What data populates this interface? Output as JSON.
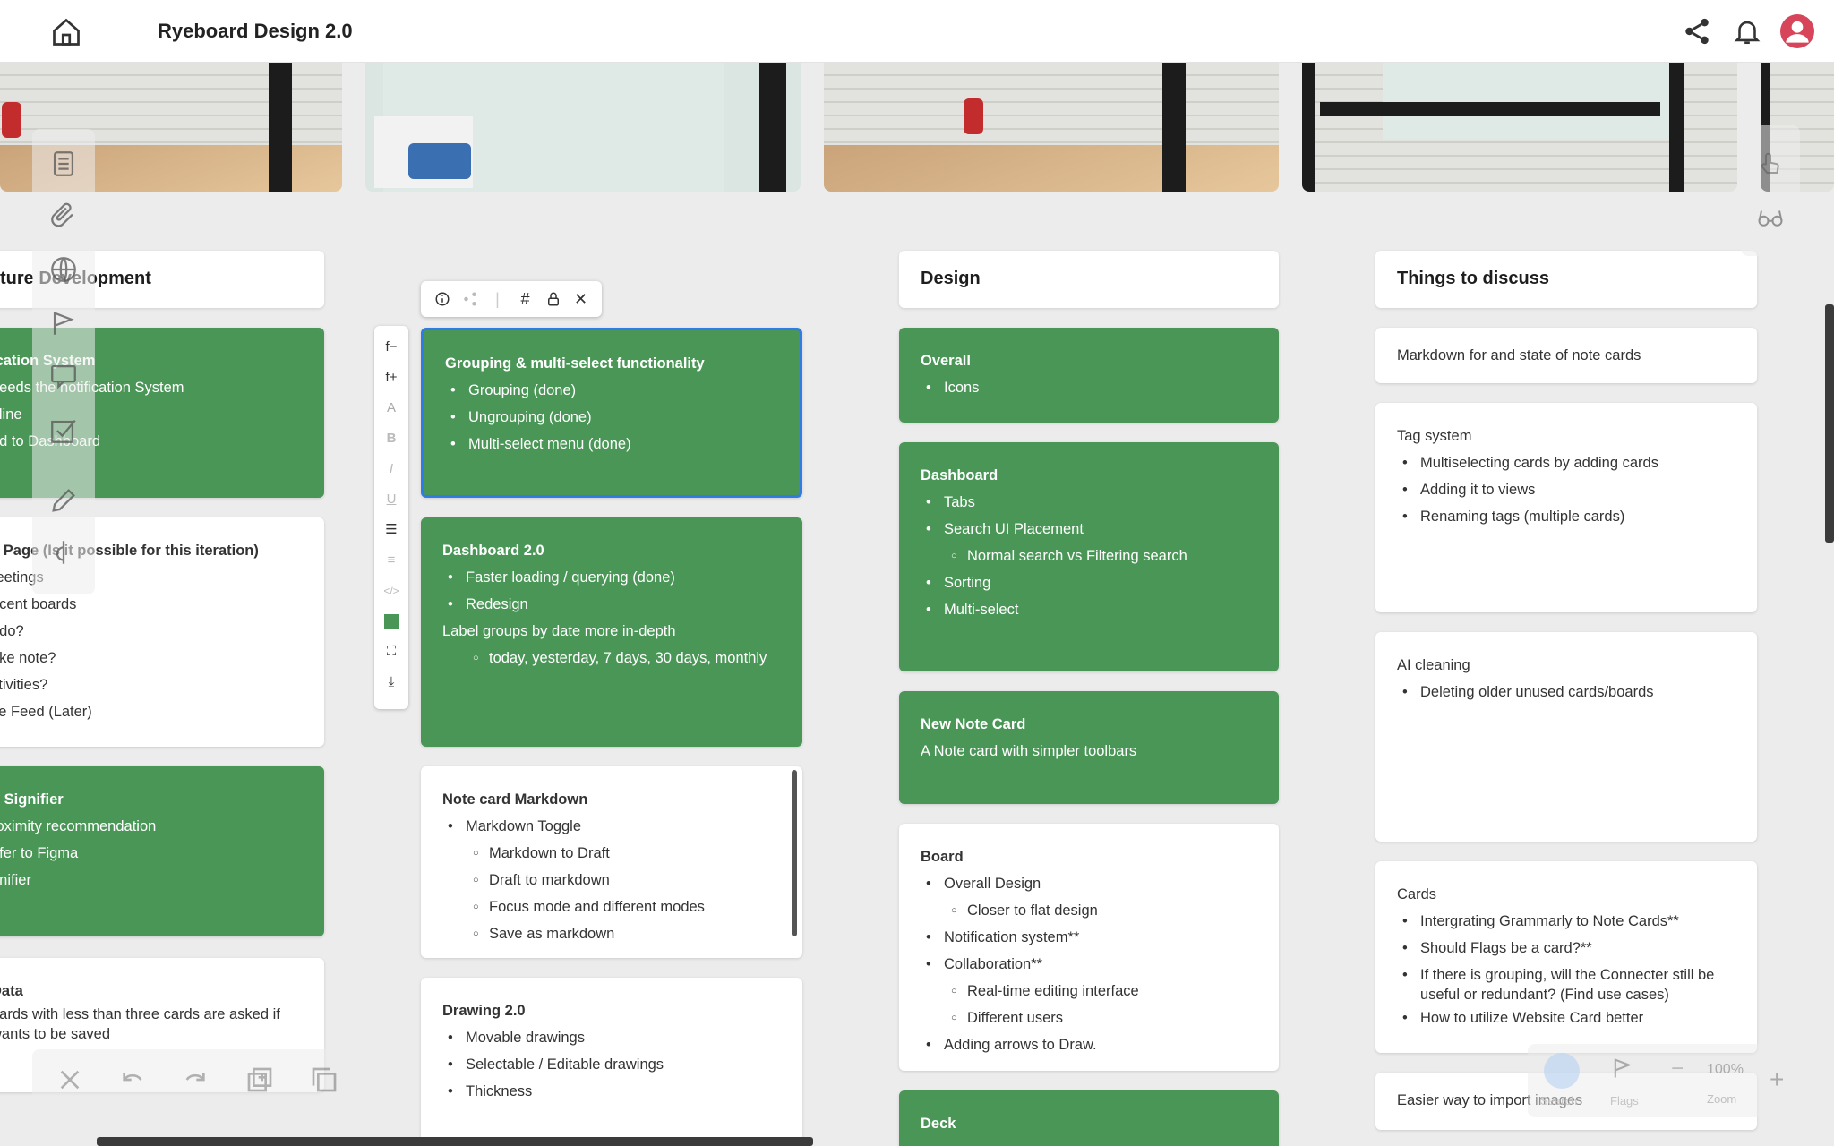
{
  "app": {
    "title": "Ryeboard Design 2.0"
  },
  "columns": {
    "left": {
      "header": "ture Development"
    },
    "design": {
      "header": "Design"
    },
    "discuss": {
      "header": "Things to discuss"
    }
  },
  "left_cards": [
    {
      "title": "ication System",
      "lines": [
        "needs the notification System",
        "ffline",
        "dd to Dashboard"
      ]
    },
    {
      "title": "e Page (Is it possible for this iteration)",
      "lines": [
        "reetings",
        "ecent boards",
        "odo?",
        "ake note?",
        "ctivities?",
        "ve Feed (Later)"
      ]
    },
    {
      "title": "p Signifier",
      "lines": [
        "roximity recommendation",
        "efer to Figma",
        "gnifier"
      ]
    },
    {
      "title": "Data",
      "lines": [
        "bards with less than three cards are asked if",
        "wants to be saved"
      ]
    }
  ],
  "mid_cards": [
    {
      "title": "Grouping & multi-select functionality",
      "items": [
        "Grouping (done)",
        "Ungrouping (done)",
        "Multi-select menu (done)"
      ]
    },
    {
      "title": "Dashboard 2.0",
      "items": [
        "Faster loading / querying (done)",
        "Redesign"
      ],
      "text": "Label groups by date more in-depth",
      "sub": "today, yesterday, 7 days, 30 days, monthly"
    },
    {
      "title": "Note card Markdown",
      "items": [
        "Markdown Toggle"
      ],
      "subs": [
        "Markdown to Draft",
        "Draft to markdown",
        "Focus mode and different modes",
        "Save as markdown"
      ]
    },
    {
      "title": "Drawing 2.0",
      "items": [
        "Movable drawings",
        "Selectable / Editable drawings",
        "Thickness"
      ]
    }
  ],
  "design_cards": [
    {
      "title": "Overall",
      "items": [
        "Icons"
      ]
    },
    {
      "title": "Dashboard",
      "items": [
        "Tabs",
        "Search UI Placement"
      ],
      "sub": "Normal search vs Filtering search",
      "items2": [
        "Sorting",
        "Multi-select"
      ]
    },
    {
      "title": "New Note Card",
      "text": "A Note card with simpler toolbars"
    },
    {
      "title": "Board",
      "items": [
        "Overall Design"
      ],
      "sub1": "Closer to flat design",
      "items2": [
        "Notification system**",
        "Collaboration**"
      ],
      "subs2": [
        "Real-time editing interface",
        "Different users"
      ],
      "items3": [
        "Adding arrows to Draw."
      ]
    },
    {
      "title": "Deck"
    }
  ],
  "discuss_cards": [
    {
      "text": "Markdown for and state of note cards"
    },
    {
      "title": "Tag system",
      "items": [
        "Multiselecting cards by adding cards",
        "Adding it to views",
        "Renaming tags (multiple cards)"
      ]
    },
    {
      "title": "AI cleaning",
      "items": [
        "Deleting older unused cards/boards"
      ]
    },
    {
      "title": "Cards",
      "items": [
        "Intergrating Grammarly to Note Cards**",
        "Should Flags be a card?**",
        "If there is grouping, will the Connecter still be",
        "useful or redundant? (Find use cases)",
        "How to utilize Website Card better"
      ]
    },
    {
      "text": "Easier way to import images"
    }
  ],
  "bottom_right": {
    "zoom_value": "100%",
    "zoom_label": "Zoom",
    "search_label": "Search",
    "flags_label": "Flags"
  },
  "colors": {
    "green_card": "#4a9657",
    "selection": "#2f7be8",
    "avatar": "#d8445a"
  }
}
